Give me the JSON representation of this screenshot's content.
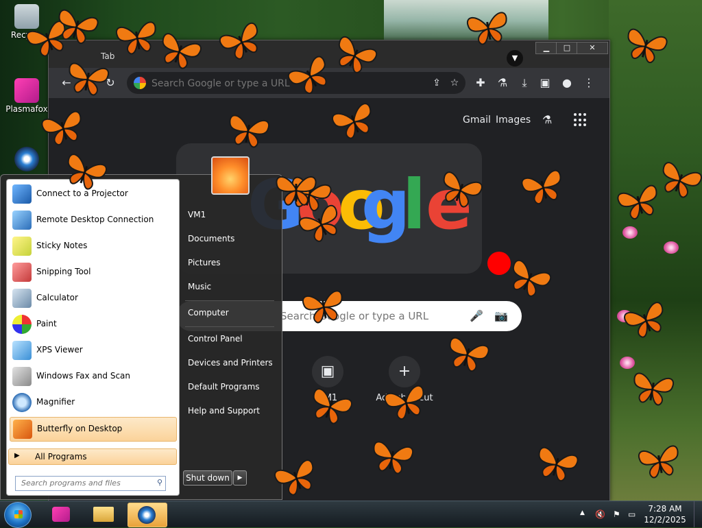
{
  "desktop": {
    "icons": [
      {
        "label": "Recycle"
      },
      {
        "label": "Plasmafox"
      }
    ]
  },
  "browser": {
    "tab_title": "Tab",
    "omnibox_placeholder": "Search Google or type a URL",
    "top_links": {
      "gmail": "Gmail",
      "images": "Images"
    },
    "logo_letters": [
      "G",
      "o",
      "o",
      "g",
      "l",
      "e"
    ],
    "search_placeholder": "Search Google or type a URL",
    "shortcuts": [
      {
        "label": "VM1"
      },
      {
        "label": "Add shortcut"
      }
    ]
  },
  "start_menu": {
    "programs": [
      {
        "label": "Connect to a Projector",
        "icon": "projector-icon"
      },
      {
        "label": "Remote Desktop Connection",
        "icon": "remote-desktop-icon"
      },
      {
        "label": "Sticky Notes",
        "icon": "sticky-notes-icon"
      },
      {
        "label": "Snipping Tool",
        "icon": "snipping-tool-icon"
      },
      {
        "label": "Calculator",
        "icon": "calculator-icon"
      },
      {
        "label": "Paint",
        "icon": "paint-icon"
      },
      {
        "label": "XPS Viewer",
        "icon": "xps-viewer-icon"
      },
      {
        "label": "Windows Fax and Scan",
        "icon": "fax-scan-icon"
      },
      {
        "label": "Magnifier",
        "icon": "magnifier-icon"
      },
      {
        "label": "Butterfly on Desktop",
        "icon": "butterfly-icon"
      }
    ],
    "all_programs": "All Programs",
    "search_placeholder": "Search programs and files",
    "places": [
      "VM1",
      "Documents",
      "Pictures",
      "Music",
      "Computer",
      "Control Panel",
      "Devices and Printers",
      "Default Programs",
      "Help and Support"
    ],
    "shutdown": "Shut down"
  },
  "taskbar": {
    "time": "7:28 AM",
    "date": "12/2/2025"
  },
  "colors": {
    "butterfly_orange": "#f07a12",
    "start_highlight": "#fbd39a",
    "google_blue": "#4285f4",
    "google_red": "#ea4335",
    "google_yellow": "#fbbc05",
    "google_green": "#34a853"
  }
}
